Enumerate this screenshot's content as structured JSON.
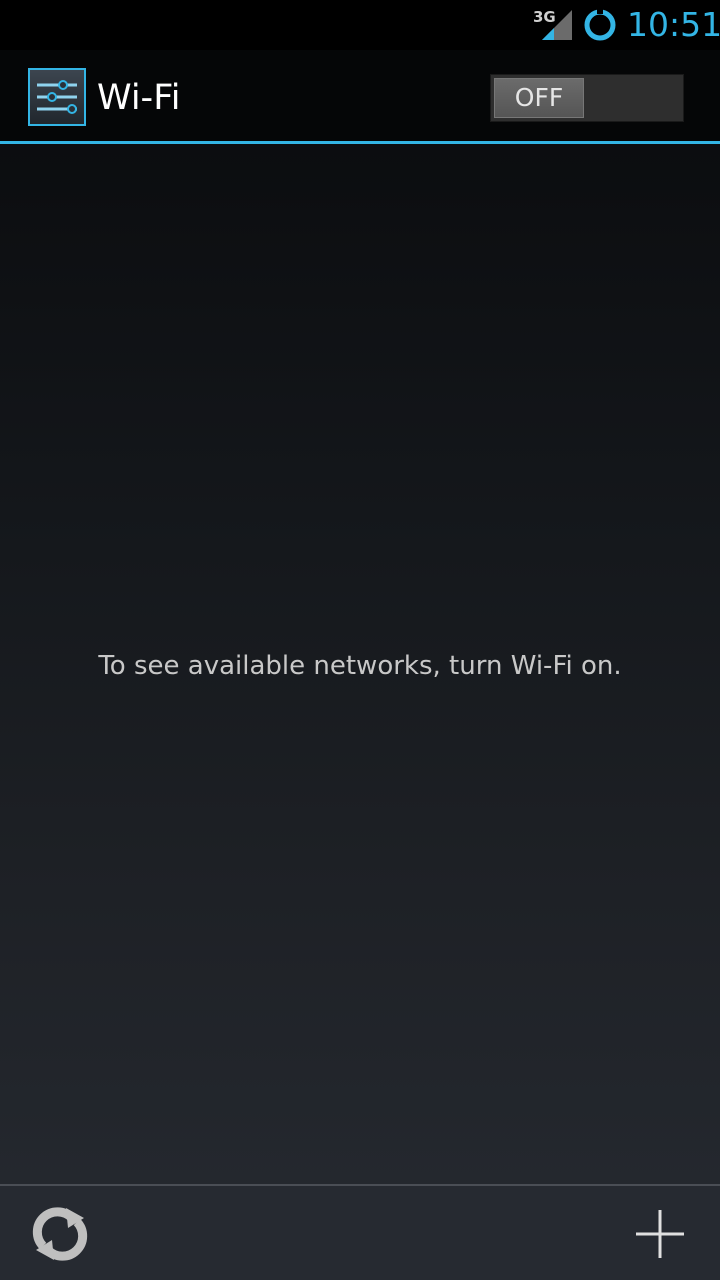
{
  "status_bar": {
    "network_type": "3G",
    "time": "10:51",
    "icons": [
      "signal-icon",
      "battery-charging-icon"
    ]
  },
  "action_bar": {
    "title": "Wi-Fi",
    "app_icon": "settings-sliders-icon",
    "wifi_toggle": {
      "label": "OFF",
      "state": "off"
    }
  },
  "main": {
    "message": "To see available networks, turn Wi-Fi on."
  },
  "bottom_bar": {
    "actions": [
      {
        "name": "scan",
        "icon": "refresh-icon"
      },
      {
        "name": "add-network",
        "icon": "plus-icon"
      }
    ]
  },
  "colors": {
    "accent": "#33b5e5",
    "background_top": "#08090b",
    "background_bottom": "#262a31"
  }
}
